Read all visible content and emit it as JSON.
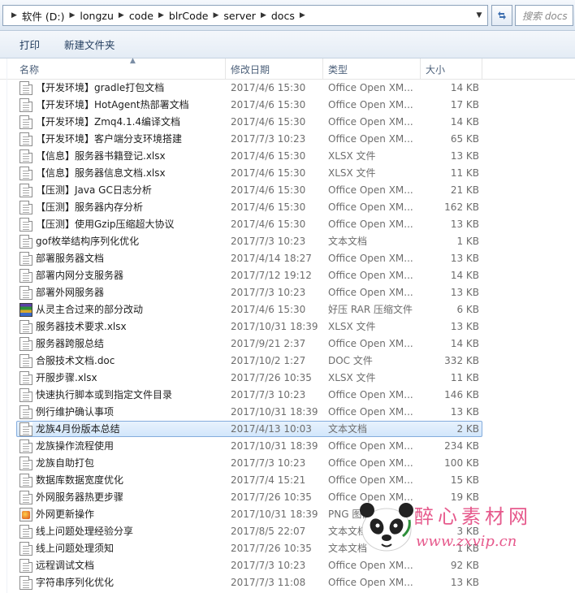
{
  "address": {
    "path": [
      "软件 (D:)",
      "longzu",
      "code",
      "blrCode",
      "server",
      "docs"
    ]
  },
  "search": {
    "placeholder": "搜索 docs"
  },
  "toolbar": {
    "print_label": "打印",
    "new_folder_label": "新建文件夹"
  },
  "columns": {
    "name": "名称",
    "date": "修改日期",
    "type": "类型",
    "size": "大小"
  },
  "files": [
    {
      "name": "【开发环境】gradle打包文档",
      "date": "2017/4/6 15:30",
      "type": "Office Open XM...",
      "size": "14 KB",
      "icon": "document-icon"
    },
    {
      "name": "【开发环境】HotAgent热部署文档",
      "date": "2017/4/6 15:30",
      "type": "Office Open XM...",
      "size": "17 KB",
      "icon": "document-icon"
    },
    {
      "name": "【开发环境】Zmq4.1.4编译文档",
      "date": "2017/4/6 15:30",
      "type": "Office Open XM...",
      "size": "14 KB",
      "icon": "document-icon"
    },
    {
      "name": "【开发环境】客户端分支环境搭建",
      "date": "2017/7/3 10:23",
      "type": "Office Open XM...",
      "size": "65 KB",
      "icon": "document-icon"
    },
    {
      "name": "【信息】服务器书籍登记.xlsx",
      "date": "2017/4/6 15:30",
      "type": "XLSX 文件",
      "size": "13 KB",
      "icon": "document-icon"
    },
    {
      "name": "【信息】服务器信息文档.xlsx",
      "date": "2017/4/6 15:30",
      "type": "XLSX 文件",
      "size": "11 KB",
      "icon": "document-icon"
    },
    {
      "name": "【压测】Java GC日志分析",
      "date": "2017/4/6 15:30",
      "type": "Office Open XM...",
      "size": "21 KB",
      "icon": "document-icon"
    },
    {
      "name": "【压测】服务器内存分析",
      "date": "2017/4/6 15:30",
      "type": "Office Open XM...",
      "size": "162 KB",
      "icon": "document-icon"
    },
    {
      "name": "【压测】使用Gzip压缩超大协议",
      "date": "2017/4/6 15:30",
      "type": "Office Open XM...",
      "size": "13 KB",
      "icon": "document-icon"
    },
    {
      "name": "gof枚举结构序列化优化",
      "date": "2017/7/3 10:23",
      "type": "文本文档",
      "size": "1 KB",
      "icon": "document-icon"
    },
    {
      "name": "部署服务器文档",
      "date": "2017/4/14 18:27",
      "type": "Office Open XM...",
      "size": "13 KB",
      "icon": "document-icon"
    },
    {
      "name": "部署内网分支服务器",
      "date": "2017/7/12 19:12",
      "type": "Office Open XM...",
      "size": "14 KB",
      "icon": "document-icon"
    },
    {
      "name": "部署外网服务器",
      "date": "2017/7/3 10:23",
      "type": "Office Open XM...",
      "size": "13 KB",
      "icon": "document-icon"
    },
    {
      "name": "从灵主合过来的部分改动",
      "date": "2017/4/6 15:30",
      "type": "好压 RAR 压缩文件",
      "size": "6 KB",
      "icon": "rar-archive-icon"
    },
    {
      "name": "服务器技术要求.xlsx",
      "date": "2017/10/31 18:39",
      "type": "XLSX 文件",
      "size": "13 KB",
      "icon": "document-icon"
    },
    {
      "name": "服务器跨服总结",
      "date": "2017/9/21 2:37",
      "type": "Office Open XM...",
      "size": "14 KB",
      "icon": "document-icon"
    },
    {
      "name": "合服技术文档.doc",
      "date": "2017/10/2 1:27",
      "type": "DOC 文件",
      "size": "332 KB",
      "icon": "document-icon"
    },
    {
      "name": "开服步骤.xlsx",
      "date": "2017/7/26 10:35",
      "type": "XLSX 文件",
      "size": "11 KB",
      "icon": "document-icon"
    },
    {
      "name": "快速执行脚本或到指定文件目录",
      "date": "2017/7/3 10:23",
      "type": "Office Open XM...",
      "size": "146 KB",
      "icon": "document-icon"
    },
    {
      "name": "例行维护确认事项",
      "date": "2017/10/31 18:39",
      "type": "Office Open XM...",
      "size": "13 KB",
      "icon": "document-icon"
    },
    {
      "name": "龙族4月份版本总结",
      "date": "2017/4/13 10:03",
      "type": "文本文档",
      "size": "2 KB",
      "icon": "document-icon",
      "selected": true
    },
    {
      "name": "龙族操作流程使用",
      "date": "2017/10/31 18:39",
      "type": "Office Open XM...",
      "size": "234 KB",
      "icon": "document-icon"
    },
    {
      "name": "龙族自助打包",
      "date": "2017/7/3 10:23",
      "type": "Office Open XM...",
      "size": "100 KB",
      "icon": "document-icon"
    },
    {
      "name": "数据库数据宽度优化",
      "date": "2017/7/4 15:21",
      "type": "Office Open XM...",
      "size": "15 KB",
      "icon": "document-icon"
    },
    {
      "name": "外网服务器热更步骤",
      "date": "2017/7/26 10:35",
      "type": "Office Open XM...",
      "size": "19 KB",
      "icon": "document-icon"
    },
    {
      "name": "外网更新操作",
      "date": "2017/10/31 18:39",
      "type": "PNG 图像",
      "size": "",
      "icon": "png-image-icon"
    },
    {
      "name": "线上问题处理经验分享",
      "date": "2017/8/5 22:07",
      "type": "文本文档",
      "size": "3 KB",
      "icon": "document-icon"
    },
    {
      "name": "线上问题处理须知",
      "date": "2017/7/26 10:35",
      "type": "文本文档",
      "size": "1 KB",
      "icon": "document-icon"
    },
    {
      "name": "远程调试文档",
      "date": "2017/7/3 10:23",
      "type": "Office Open XM...",
      "size": "92 KB",
      "icon": "document-icon"
    },
    {
      "name": "字符串序列化优化",
      "date": "2017/7/3 11:08",
      "type": "Office Open XM...",
      "size": "13 KB",
      "icon": "document-icon"
    }
  ],
  "watermark": {
    "title": "醉心素材网",
    "url": "www.zxvip.cn"
  }
}
